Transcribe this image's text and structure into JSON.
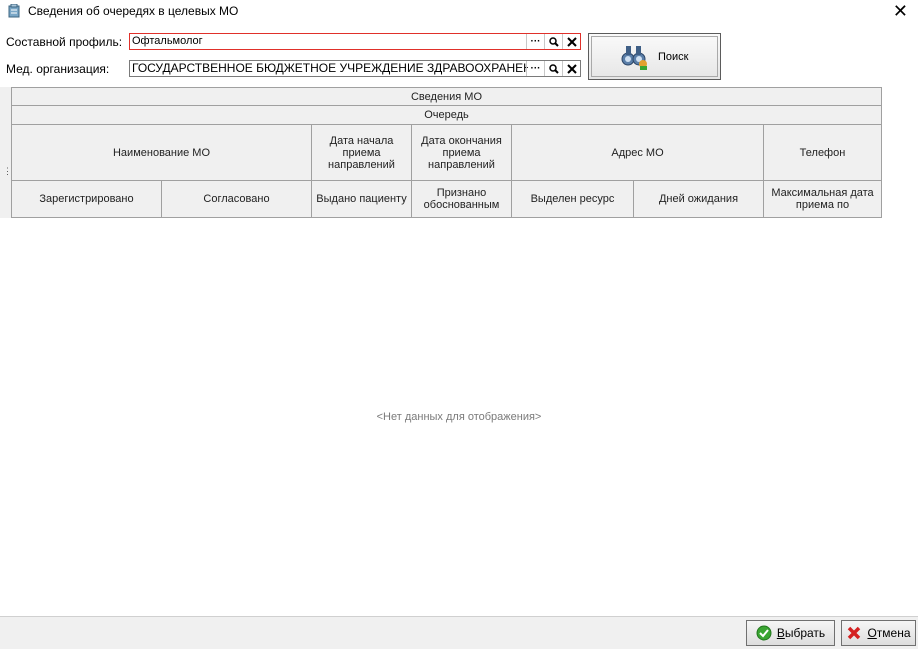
{
  "window": {
    "title": "Сведения об очередях в целевых МО"
  },
  "filters": {
    "profile_label": "Составной профиль:",
    "profile_value": "Офтальмолог",
    "org_label": "Мед. организация:",
    "org_value": "ГОСУДАРСТВЕННОЕ БЮДЖЕТНОЕ УЧРЕЖДЕНИЕ ЗДРАВООХРАНЕНИЯ",
    "ellipsis": "···"
  },
  "search_button": {
    "label": "Поиск"
  },
  "grid": {
    "band_top": "Сведения МО",
    "band_queue": "Очередь",
    "columns_row1": [
      "Наименование МО",
      "Дата начала приема направлений",
      "Дата окончания приема направлений",
      "Адрес МО",
      "Телефон"
    ],
    "columns_row2": [
      "Зарегистрировано",
      "Согласовано",
      "Выдано пациенту",
      "Признано обоснованным",
      "Выделен ресурс",
      "Дней ожидания",
      "Максимальная дата приема по"
    ],
    "empty_text": "<Нет данных для отображения>"
  },
  "footer": {
    "select_first": "В",
    "select_rest": "ыбрать",
    "cancel_first": "О",
    "cancel_rest": "тмена"
  },
  "colors": {
    "required_border": "#e0302a",
    "ok_icon": "#3aa532",
    "cancel_icon": "#d42020"
  }
}
